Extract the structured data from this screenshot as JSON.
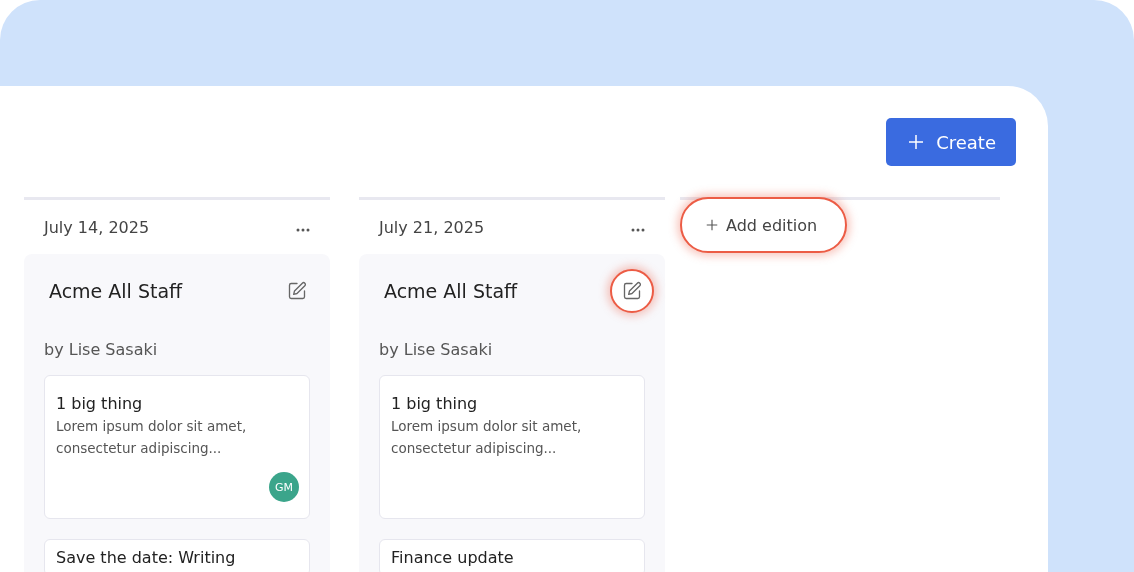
{
  "toolbar": {
    "create_button": {
      "label": "Create"
    }
  },
  "editions": [
    {
      "date": "July 14, 2025",
      "title": "Acme All Staff",
      "byline": "by Lise Sasaki",
      "edit_highlighted": false,
      "items": [
        {
          "title": "1 big thing",
          "excerpt": "Lorem ipsum dolor sit amet, consectetur adipiscing...",
          "assignee": "GM",
          "color": "#3ba58b"
        },
        {
          "title": "Save the date: Writing"
        }
      ]
    },
    {
      "date": "July 21, 2025",
      "title": "Acme All Staff",
      "byline": "by Lise Sasaki",
      "edit_highlighted": true,
      "items": [
        {
          "title": "1 big thing",
          "excerpt": "Lorem ipsum dolor sit amet, consectetur adipiscing..."
        },
        {
          "title": "Finance update"
        }
      ]
    }
  ],
  "add_edition": {
    "label": "Add edition",
    "highlighted": true
  }
}
